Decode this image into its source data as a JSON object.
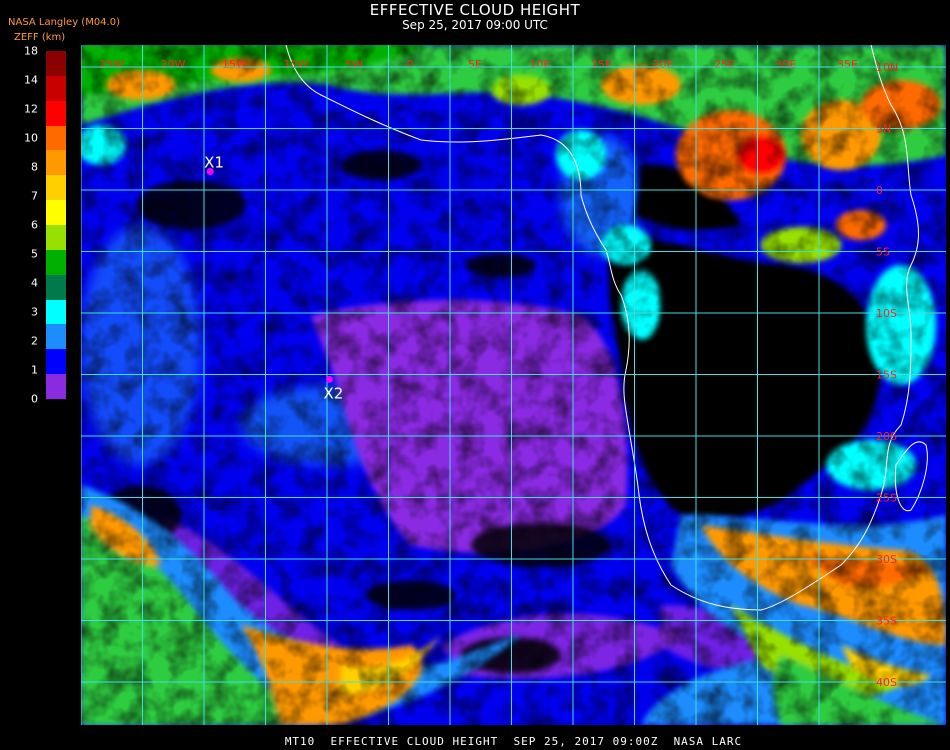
{
  "header": {
    "title": "EFFECTIVE CLOUD HEIGHT",
    "subtitle": "Sep 25, 2017 09:00 UTC",
    "provider": "NASA Langley (M04.0)",
    "units": "ZEFF (km)"
  },
  "colorbar": {
    "labels": [
      "18",
      "14",
      "12",
      "10",
      "8",
      "7",
      "6",
      "5",
      "4",
      "3",
      "2",
      "1",
      "0"
    ],
    "colors": [
      "#8b0000",
      "#c80000",
      "#ff0000",
      "#ff6a00",
      "#ff9900",
      "#ffd000",
      "#ffff00",
      "#98e000",
      "#00b000",
      "#007a4a",
      "#00ffff",
      "#1c8cff",
      "#0000ff",
      "#8a2be2"
    ]
  },
  "map": {
    "longitude_labels": [
      "25W",
      "20W",
      "15W",
      "10W",
      "5W",
      "0",
      "5E",
      "10E",
      "15E",
      "20E",
      "25E",
      "30E",
      "35E"
    ],
    "latitude_labels": [
      "10N",
      "5N",
      "0",
      "5S",
      "10S",
      "15S",
      "20S",
      "25S",
      "30S",
      "35S",
      "40S"
    ],
    "markers": [
      {
        "label": "X1",
        "lon": -14.5,
        "lat": 1.5,
        "color": "#ff00ff"
      },
      {
        "label": "X2",
        "lon": -4.8,
        "lat": -15.4,
        "color": "#ff00ff"
      }
    ],
    "grid_color": "#40e0e0",
    "coastline_color": "#ffffff"
  },
  "footer": "MT10  EFFECTIVE CLOUD HEIGHT  SEP 25, 2017 09:00Z  NASA LARC"
}
